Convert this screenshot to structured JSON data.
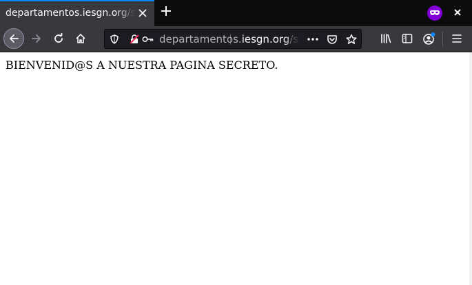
{
  "tab": {
    "title": "departamentos.iesgn.org/secreto",
    "close_icon": "close-icon"
  },
  "window": {
    "newtab_icon": "plus-icon",
    "private_icon": "private-browsing-mask-icon",
    "close_icon": "close-icon"
  },
  "toolbar": {
    "back_icon": "arrow-left-icon",
    "forward_icon": "arrow-right-icon",
    "reload_icon": "reload-icon",
    "home_icon": "home-icon",
    "library_icon": "library-icon",
    "sidebar_icon": "sidebar-icon",
    "account_icon": "account-icon",
    "menu_icon": "hamburger-menu-icon"
  },
  "urlbar": {
    "host_prefix": "departamentos.",
    "host_domain": "iesgn.org",
    "path": "/secreto",
    "icons": [
      "shield-icon",
      "insecure-lock-icon",
      "key-icon",
      "more-actions-icon",
      "pocket-icon",
      "star-icon"
    ]
  },
  "page": {
    "body_text": "BIENVENID@S A NUESTRA PAGINA SECRETO."
  },
  "colors": {
    "tabbar_bg": "#0c0c0d",
    "toolbar_bg": "#38383d",
    "urlbar_bg": "#1c1b22",
    "accent": "#0a84ff",
    "private_purple": "#8000d7",
    "insecure_red": "#e22850"
  }
}
